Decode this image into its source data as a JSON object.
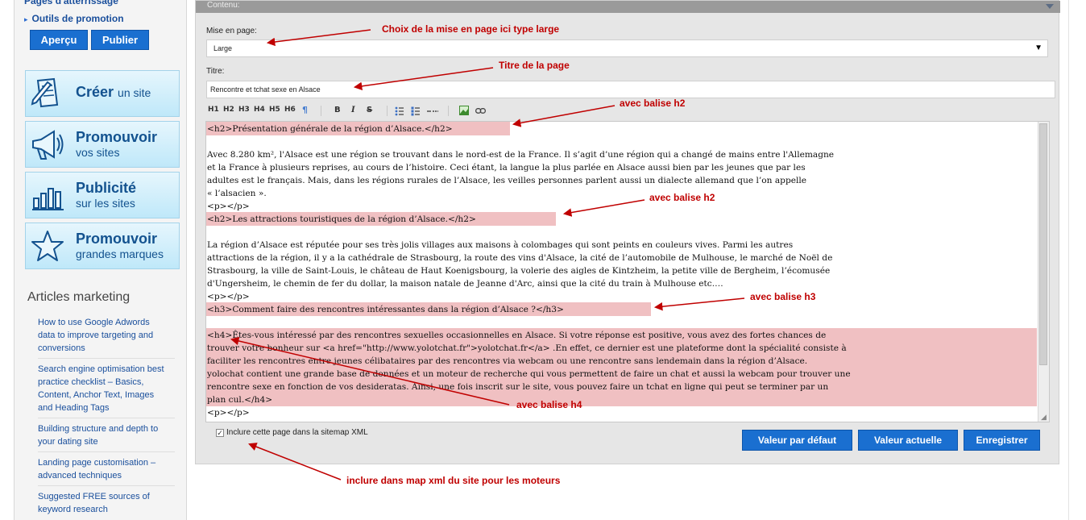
{
  "sidebar": {
    "cut_link": "Pages d'atterrissage",
    "promo_link": "Outils de promotion",
    "preview_button": "Aperçu",
    "publish_button": "Publier",
    "tiles": [
      {
        "title": "Créer",
        "subtitle": "un site",
        "icon": "document-pencil-icon"
      },
      {
        "title": "Promouvoir",
        "subtitle": "vos sites",
        "icon": "megaphone-icon"
      },
      {
        "title": "Publicité",
        "subtitle": "sur les sites",
        "icon": "bar-chart-icon"
      },
      {
        "title": "Promouvoir",
        "subtitle": "grandes marques",
        "icon": "star-icon"
      }
    ],
    "articles_title": "Articles marketing",
    "articles": [
      {
        "lines": [
          "How to use Google Adwords",
          "data to improve targeting and",
          "conversions"
        ]
      },
      {
        "lines": [
          "Search engine optimisation best",
          "practice checklist – Basics,",
          "Content, Anchor Text, Images",
          "and Heading Tags"
        ]
      },
      {
        "lines": [
          "Building structure and depth to",
          "your dating site"
        ]
      },
      {
        "lines": [
          "Landing page customisation –",
          "advanced techniques"
        ]
      },
      {
        "lines": [
          "Suggested FREE sources of",
          "keyword research"
        ]
      }
    ]
  },
  "panel": {
    "header": "Contenu:",
    "layout_label": "Mise en page:",
    "layout_value": "Large",
    "title_label": "Titre:",
    "title_value": "Rencontre et tchat sexe en Alsace",
    "toolbar": [
      "H1",
      "H2",
      "H3",
      "H4",
      "H5",
      "H6",
      "¶",
      "B",
      "I",
      "S"
    ],
    "editor_lines": [
      "<h2>Présentation générale de la région d’Alsace.</h2>",
      "",
      "Avec 8.280 km², l'Alsace est une région se trouvant dans le nord-est de la France. Il s’agit d’une région qui a changé de mains entre l'Allemagne",
      "et la France à plusieurs reprises, au cours de l’histoire. Ceci étant, la langue la plus parlée en Alsace aussi bien par les jeunes que par les",
      "adultes est le français. Mais, dans les régions rurales de l’Alsace, les veilles personnes parlent aussi un dialecte allemand que l’on appelle",
      "« l’alsacien ».",
      "<p></p>",
      "<h2>Les attractions touristiques de la région d’Alsace.</h2>",
      "",
      "La région d’Alsace est réputée pour ses très jolis villages aux maisons à colombages qui sont peints en couleurs vives. Parmi les autres",
      "attractions de la région, il y a la cathédrale de Strasbourg, la route des vins d'Alsace, la cité de l’automobile de Mulhouse, le marché de Noël de",
      "Strasbourg, la ville de Saint-Louis, le château de Haut Koenigsbourg, la volerie des aigles de Kintzheim, la petite ville de Bergheim, l’écomusée",
      "d'Ungersheim, le chemin de fer du dollar, la maison natale de Jeanne d'Arc, ainsi que la cité du train à Mulhouse etc.…",
      "<p></p>",
      "<h3>Comment faire des rencontres intéressantes dans la région d’Alsace ?</h3>",
      "",
      "<h4>Êtes-vous intéressé par des rencontres sexuelles occasionnelles en Alsace. Si votre réponse est positive, vous avez des fortes chances de",
      "trouver votre bonheur sur <a href=\"http://www.yolotchat.fr\">yolotchat.fr</a> .En effet, ce dernier est une plateforme dont la spécialité consiste à",
      "faciliter les rencontres entre jeunes célibataires par des rencontres via webcam ou une rencontre sans lendemain dans la région d’Alsace.",
      "yolochat contient une grande base de données et un moteur de recherche qui vous permettent de faire un chat et aussi la webcam pour trouver une",
      "rencontre sexe en fonction de vos desideratas. Ainsi, une fois inscrit sur le site, vous pouvez faire un tchat en ligne qui peut se terminer par un",
      "plan cul.</h4>",
      "<p></p>"
    ],
    "sitemap_label": "Inclure cette page dans la sitemap XML",
    "sitemap_checked": true,
    "buttons": {
      "default": "Valeur par défaut",
      "current": "Valeur actuelle",
      "save": "Enregistrer"
    }
  },
  "annotations": {
    "layout": "Choix de la mise en page ici  type large",
    "title": "Titre de la page",
    "h2a": "avec balise h2",
    "h2b": "avec balise h2",
    "h3": "avec balise h3",
    "h4": "avec balise h4",
    "sitemap": "inclure dans map xml du site pour les moteurs"
  },
  "colors": {
    "accent_blue": "#1a6fd0",
    "highlight": "#f0c0c2",
    "annotation_red": "#c00000",
    "tile_text": "#13528f"
  }
}
